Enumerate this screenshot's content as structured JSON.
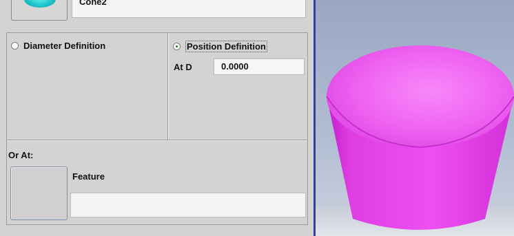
{
  "header": {
    "thumbnail_icon": "cone-icon",
    "name_value": "Cone2"
  },
  "definition": {
    "diameter_option": {
      "label": "Diameter Definition",
      "selected": false
    },
    "position_option": {
      "label": "Position Definition",
      "selected": true
    },
    "at_label": "At D",
    "at_value": "0.0000"
  },
  "or_at": {
    "label": "Or At:",
    "feature_label": "Feature",
    "feature_value": ""
  },
  "viewport": {
    "shape": "truncated-cone",
    "shape_color": "#e23fe6",
    "background_color": "#a6b2cb",
    "divider_color": "#2f3f9a"
  }
}
